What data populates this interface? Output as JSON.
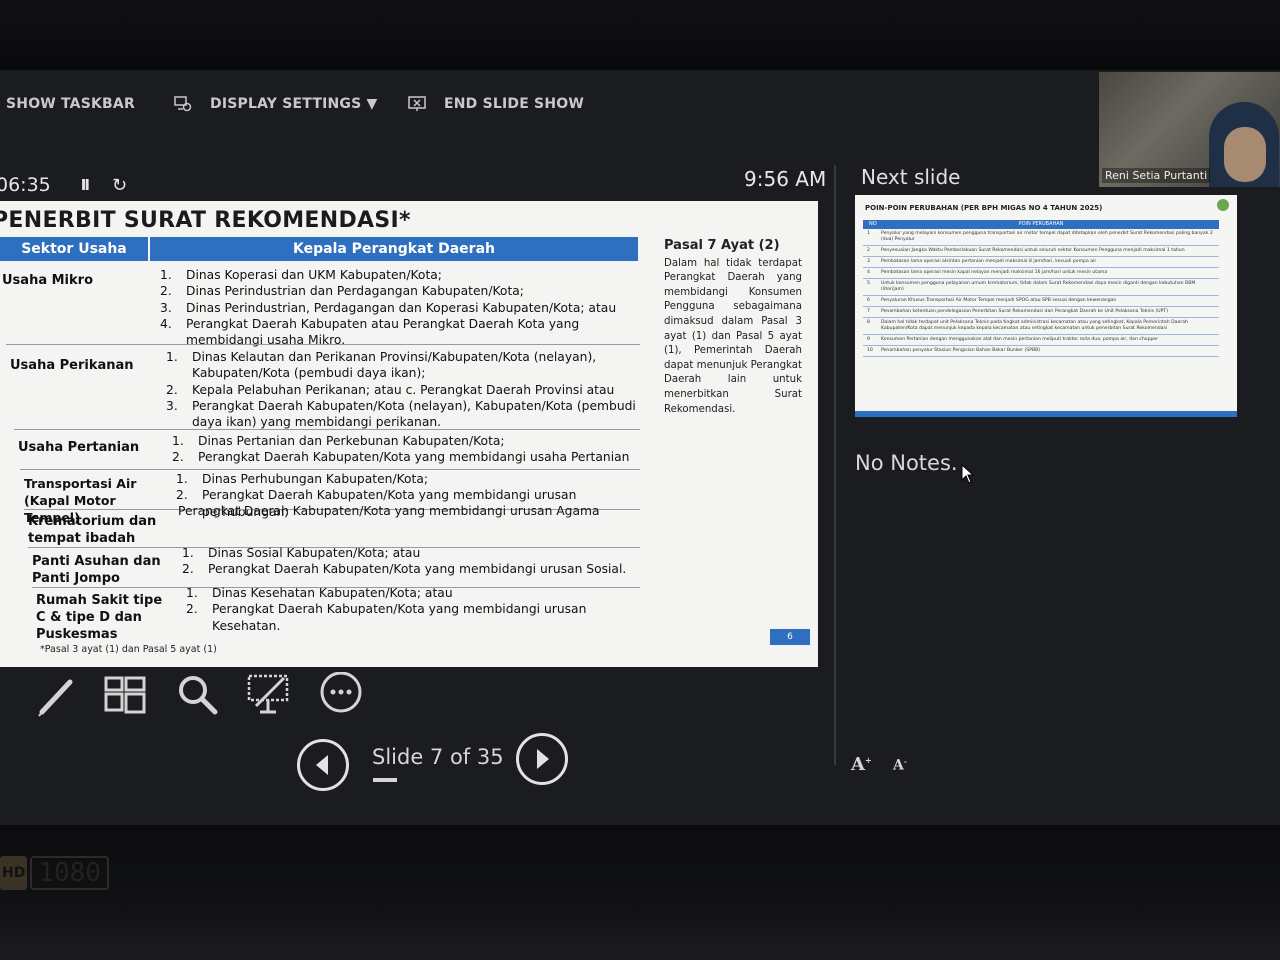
{
  "toolbar": {
    "show_taskbar": "SHOW TASKBAR",
    "display_settings": "DISPLAY SETTINGS ▼",
    "end_slide_show": "END SLIDE SHOW"
  },
  "timer": {
    "elapsed": "06:35",
    "pause_glyph": "II",
    "reset_glyph": "↻"
  },
  "clock": "9:56 AM",
  "next_slide_label": "Next slide",
  "webcam": {
    "participant_name": "Reni Setia Purtanti"
  },
  "current_slide": {
    "title": "PENERBIT SURAT REKOMENDASI*",
    "col_sector": "Sektor Usaha",
    "col_agency": "Kepala Perangkat Daerah",
    "rows": [
      {
        "sector": "Usaha Mikro",
        "items": [
          {
            "n": "1.",
            "t": "Dinas Koperasi dan UKM Kabupaten/Kota;"
          },
          {
            "n": "2.",
            "t": "Dinas Perindustrian dan Perdagangan Kabupaten/Kota;"
          },
          {
            "n": "3.",
            "t": "Dinas Perindustrian, Perdagangan dan Koperasi Kabupaten/Kota; atau"
          },
          {
            "n": "4.",
            "t": "Perangkat Daerah Kabupaten atau Perangkat Daerah Kota yang membidangi usaha Mikro."
          }
        ]
      },
      {
        "sector": "Usaha Perikanan",
        "items": [
          {
            "n": "1.",
            "t": "Dinas Kelautan dan Perikanan Provinsi/Kabupaten/Kota (nelayan), Kabupaten/Kota (pembudi daya ikan);"
          },
          {
            "n": "2.",
            "t": "Kepala Pelabuhan Perikanan; atau c. Perangkat Daerah Provinsi atau"
          },
          {
            "n": "3.",
            "t": "Perangkat Daerah Kabupaten/Kota (nelayan), Kabupaten/Kota (pembudi daya ikan) yang membidangi perikanan."
          }
        ]
      },
      {
        "sector": "Usaha Pertanian",
        "items": [
          {
            "n": "1.",
            "t": "Dinas Pertanian dan Perkebunan Kabupaten/Kota;"
          },
          {
            "n": "2.",
            "t": "Perangkat Daerah Kabupaten/Kota yang membidangi usaha Pertanian"
          }
        ]
      },
      {
        "sector": "Transportasi Air (Kapal Motor Tempel)",
        "items": [
          {
            "n": "1.",
            "t": "Dinas Perhubungan Kabupaten/Kota;"
          },
          {
            "n": "2.",
            "t": "Perangkat Daerah Kabupaten/Kota yang membidangi urusan perhubungan;"
          }
        ]
      },
      {
        "sector": "Krematorium dan tempat ibadah",
        "items": [
          {
            "n": "",
            "t": "Perangkat Daerah Kabupaten/Kota yang membidangi urusan Agama"
          }
        ]
      },
      {
        "sector": "Panti Asuhan dan Panti Jompo",
        "items": [
          {
            "n": "1.",
            "t": "Dinas Sosial Kabupaten/Kota; atau"
          },
          {
            "n": "2.",
            "t": "Perangkat Daerah Kabupaten/Kota yang membidangi urusan Sosial."
          }
        ]
      },
      {
        "sector": "Rumah Sakit tipe C & tipe D dan Puskesmas",
        "items": [
          {
            "n": "1.",
            "t": "Dinas Kesehatan Kabupaten/Kota; atau"
          },
          {
            "n": "2.",
            "t": "Perangkat Daerah Kabupaten/Kota yang membidangi urusan Kesehatan."
          }
        ]
      }
    ],
    "pasal_title": "Pasal 7 Ayat (2)",
    "pasal_text": "Dalam hal tidak terdapat Perangkat Daerah yang membidangi Konsumen Pengguna sebagaimana dimaksud dalam Pasal 3 ayat (1) dan Pasal 5 ayat (1), Pemerintah Daerah dapat menunjuk Perangkat Daerah lain untuk menerbitkan Surat Rekomendasi.",
    "footnote": "*Pasal 3 ayat (1) dan Pasal 5 ayat (1)",
    "page_number": "6"
  },
  "next_slide": {
    "title": "POIN-POIN PERUBAHAN (PER BPH MIGAS NO 4 TAHUN 2025)",
    "col_no": "NO",
    "col_header": "POIN PERUBAHAN",
    "rows": [
      {
        "n": "1",
        "t": "Penyalur yang melayani konsumen pengguna transportasi air motor tempel dapat ditetapkan oleh penerbit Surat Rekomendasi paling banyak 2 (dua) Penyalur"
      },
      {
        "n": "2",
        "t": "Penyesuaian Jangka Waktu Pemberlakuan Surat Rekomendasi untuk seluruh sektor Konsumen Pengguna menjadi maksimal 1 tahun"
      },
      {
        "n": "3",
        "t": "Pembatasan lama operasi alsintan pertanian menjadi maksimal 8 jam/hari, kecuali pompa air"
      },
      {
        "n": "4",
        "t": "Pembatasan lama operasi mesin kapal nelayan menjadi maksimal 16 jam/hari untuk mesin utama"
      },
      {
        "n": "5",
        "t": "Untuk konsumen pengguna pelayanan umum krematorium, tidak dalam Surat Rekomendasi daya mesin diganti dengan kebutuhan BBM (liter/jam)"
      },
      {
        "n": "6",
        "t": "Penyaluran Khusus Transportasi Air Motor Tempel menjadi SPOG atau SPB sesuai dengan kewenangan"
      },
      {
        "n": "7",
        "t": "Penambahan ketentuan pendelegasian Penerbitan Surat Rekomendasi dari Perangkat Daerah ke Unit Pelaksana Teknis (UPT)"
      },
      {
        "n": "8",
        "t": "Dalam hal tidak terdapat unit Pelaksana Teknis pada tingkat administrasi kecamatan atau yang setingkat, Kepala Pemerintah Daerah Kabupaten/Kota dapat menunjuk kepada kepala kecamatan atau setingkat kecamatan untuk penerbitan Surat Rekomendasi"
      },
      {
        "n": "9",
        "t": "Konsumen Pertanian dengan menggunakan alat dan mesin pertanian meliputi traktor roda dua, pompa air, dan chopper"
      },
      {
        "n": "10",
        "t": "Penambahan penyalur Stasiun Pengisian Bahan Bakar Bunker (SPBB)"
      }
    ]
  },
  "notes_text": "No Notes.",
  "navigation": {
    "slide_counter": "Slide 7 of 35",
    "progress": 0.2
  },
  "font_controls": {
    "increase": "A",
    "decrease": "A"
  },
  "monitor_badge": {
    "hd": "HD",
    "resolution": "1080"
  }
}
